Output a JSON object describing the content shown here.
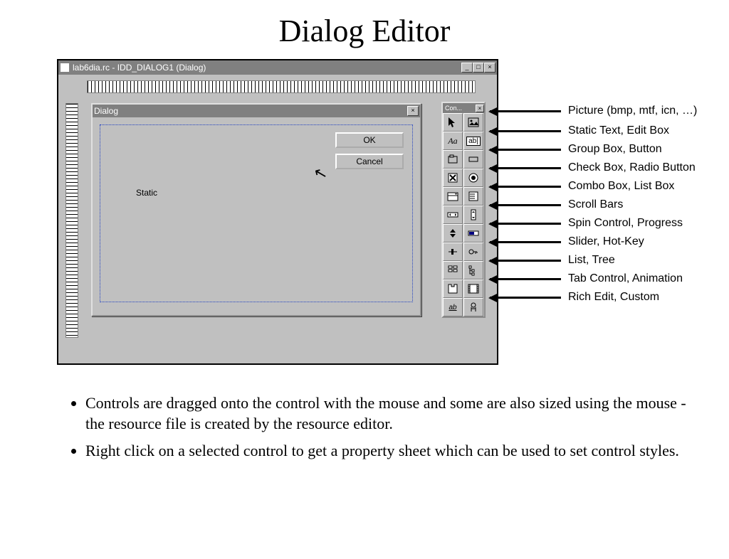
{
  "slide": {
    "title": "Dialog Editor"
  },
  "window": {
    "title": "lab6dia.rc - IDD_DIALOG1 (Dialog)"
  },
  "dialog": {
    "title": "Dialog",
    "ok_label": "OK",
    "cancel_label": "Cancel",
    "static_label": "Static"
  },
  "palette": {
    "title": "Con...",
    "tools": [
      {
        "name": "pointer-icon"
      },
      {
        "name": "picture-icon"
      },
      {
        "name": "static-text-icon"
      },
      {
        "name": "edit-box-icon"
      },
      {
        "name": "group-box-icon"
      },
      {
        "name": "button-icon"
      },
      {
        "name": "check-box-icon"
      },
      {
        "name": "radio-button-icon"
      },
      {
        "name": "combo-box-icon"
      },
      {
        "name": "list-box-icon"
      },
      {
        "name": "hscroll-icon"
      },
      {
        "name": "vscroll-icon"
      },
      {
        "name": "spin-icon"
      },
      {
        "name": "progress-icon"
      },
      {
        "name": "slider-icon"
      },
      {
        "name": "hotkey-icon"
      },
      {
        "name": "list-ctrl-icon"
      },
      {
        "name": "tree-ctrl-icon"
      },
      {
        "name": "tab-ctrl-icon"
      },
      {
        "name": "animation-icon"
      },
      {
        "name": "richedit-icon"
      },
      {
        "name": "custom-icon"
      }
    ]
  },
  "annotations": [
    "Picture (bmp, mtf, icn, …)",
    "Static Text, Edit Box",
    "Group Box, Button",
    "Check Box, Radio Button",
    "Combo Box, List Box",
    "Scroll Bars",
    "Spin Control, Progress",
    "Slider, Hot-Key",
    "List, Tree",
    "Tab Control, Animation",
    "Rich Edit, Custom"
  ],
  "bullets": [
    "Controls are dragged onto the control with the mouse and some are also sized using the mouse - the resource file is created by the resource editor.",
    "Right click on a selected control to get a property sheet which can be used to set control styles."
  ]
}
